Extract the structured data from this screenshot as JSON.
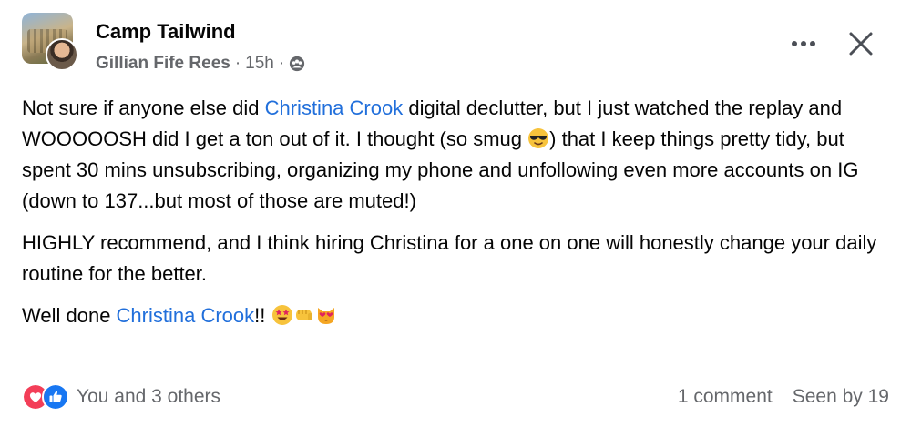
{
  "post": {
    "group_name": "Camp Tailwind",
    "author": "Gillian Fife Rees",
    "separator": "·",
    "time": "15h",
    "privacy_icon": "group-members-icon"
  },
  "header_actions": {
    "more_icon": "more-options-icon",
    "close_icon": "close-icon"
  },
  "body": {
    "p1": {
      "part1": "Not sure if anyone else did ",
      "mention": "Christina Crook",
      "part2": " digital declutter, but I just watched the replay and WOOOOOSH did I get a ton out of it. I thought (so smug ",
      "emoji": "sunglasses-emoji",
      "part3": ") that I keep things pretty tidy, but spent 30 mins unsubscribing, organizing my phone and unfollowing even more accounts on IG (down to 137...but most of those are muted!)"
    },
    "p2": "HIGHLY recommend, and I think hiring Christina for a one on one will honestly change your daily routine for the better.",
    "p3": {
      "part1": "Well done ",
      "mention": "Christina Crook",
      "part2": "!! ",
      "emojis": [
        "star-struck-emoji",
        "fist-bump-emoji",
        "heart-eyes-cat-emoji"
      ]
    }
  },
  "footer": {
    "reactions": [
      "love-reaction-icon",
      "like-reaction-icon"
    ],
    "reactions_text": "You and 3 others",
    "comments": "1 comment",
    "seen_by": "Seen by 19"
  },
  "colors": {
    "mention": "#216fdb",
    "secondary_text": "#65676b",
    "love": "#f33e58",
    "like": "#1877f2"
  }
}
